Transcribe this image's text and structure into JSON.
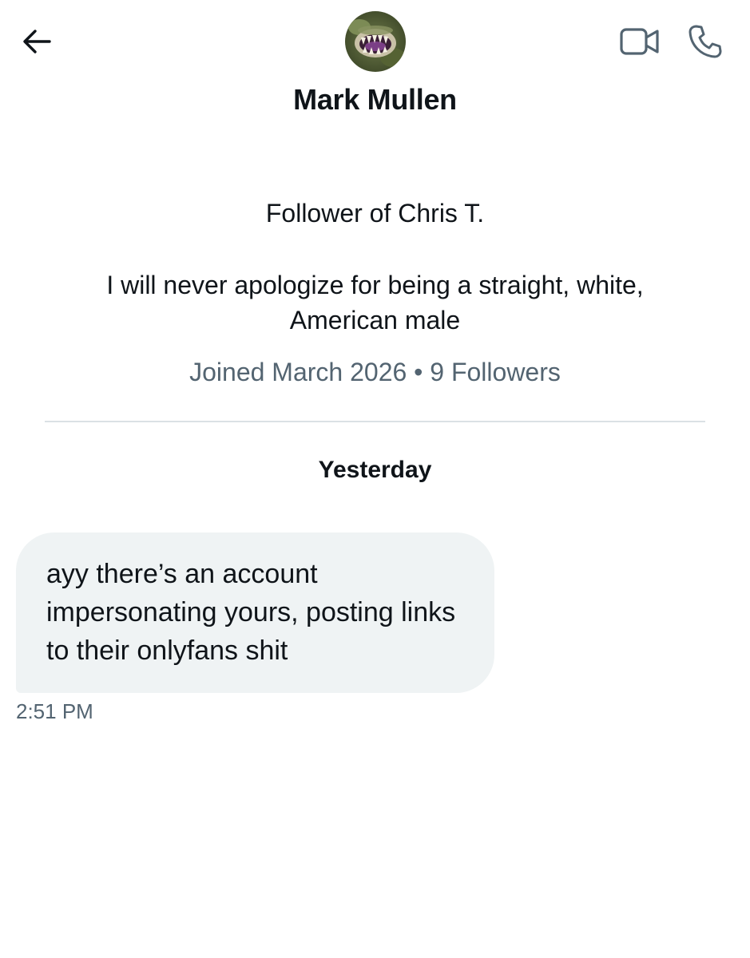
{
  "conversation": {
    "contact_name": "Mark Mullen",
    "bio_line1": "Follower of Chris T.",
    "bio_line2": "I will never apologize for being a straight, white, American male",
    "joined": "Joined March 2026",
    "separator": "•",
    "followers": "9 Followers"
  },
  "messages": {
    "day_label": "Yesterday",
    "items": [
      {
        "text": "ayy there’s an account impersonating yours, posting links to their onlyfans shit",
        "time": "2:51 PM"
      }
    ]
  },
  "icons": {
    "back": "arrow-left-icon",
    "video": "video-camera-icon",
    "phone": "phone-icon"
  },
  "colors": {
    "text_primary": "#0f1419",
    "text_secondary": "#536471",
    "bubble_bg": "#eff3f4",
    "divider": "#dbe1e5"
  }
}
